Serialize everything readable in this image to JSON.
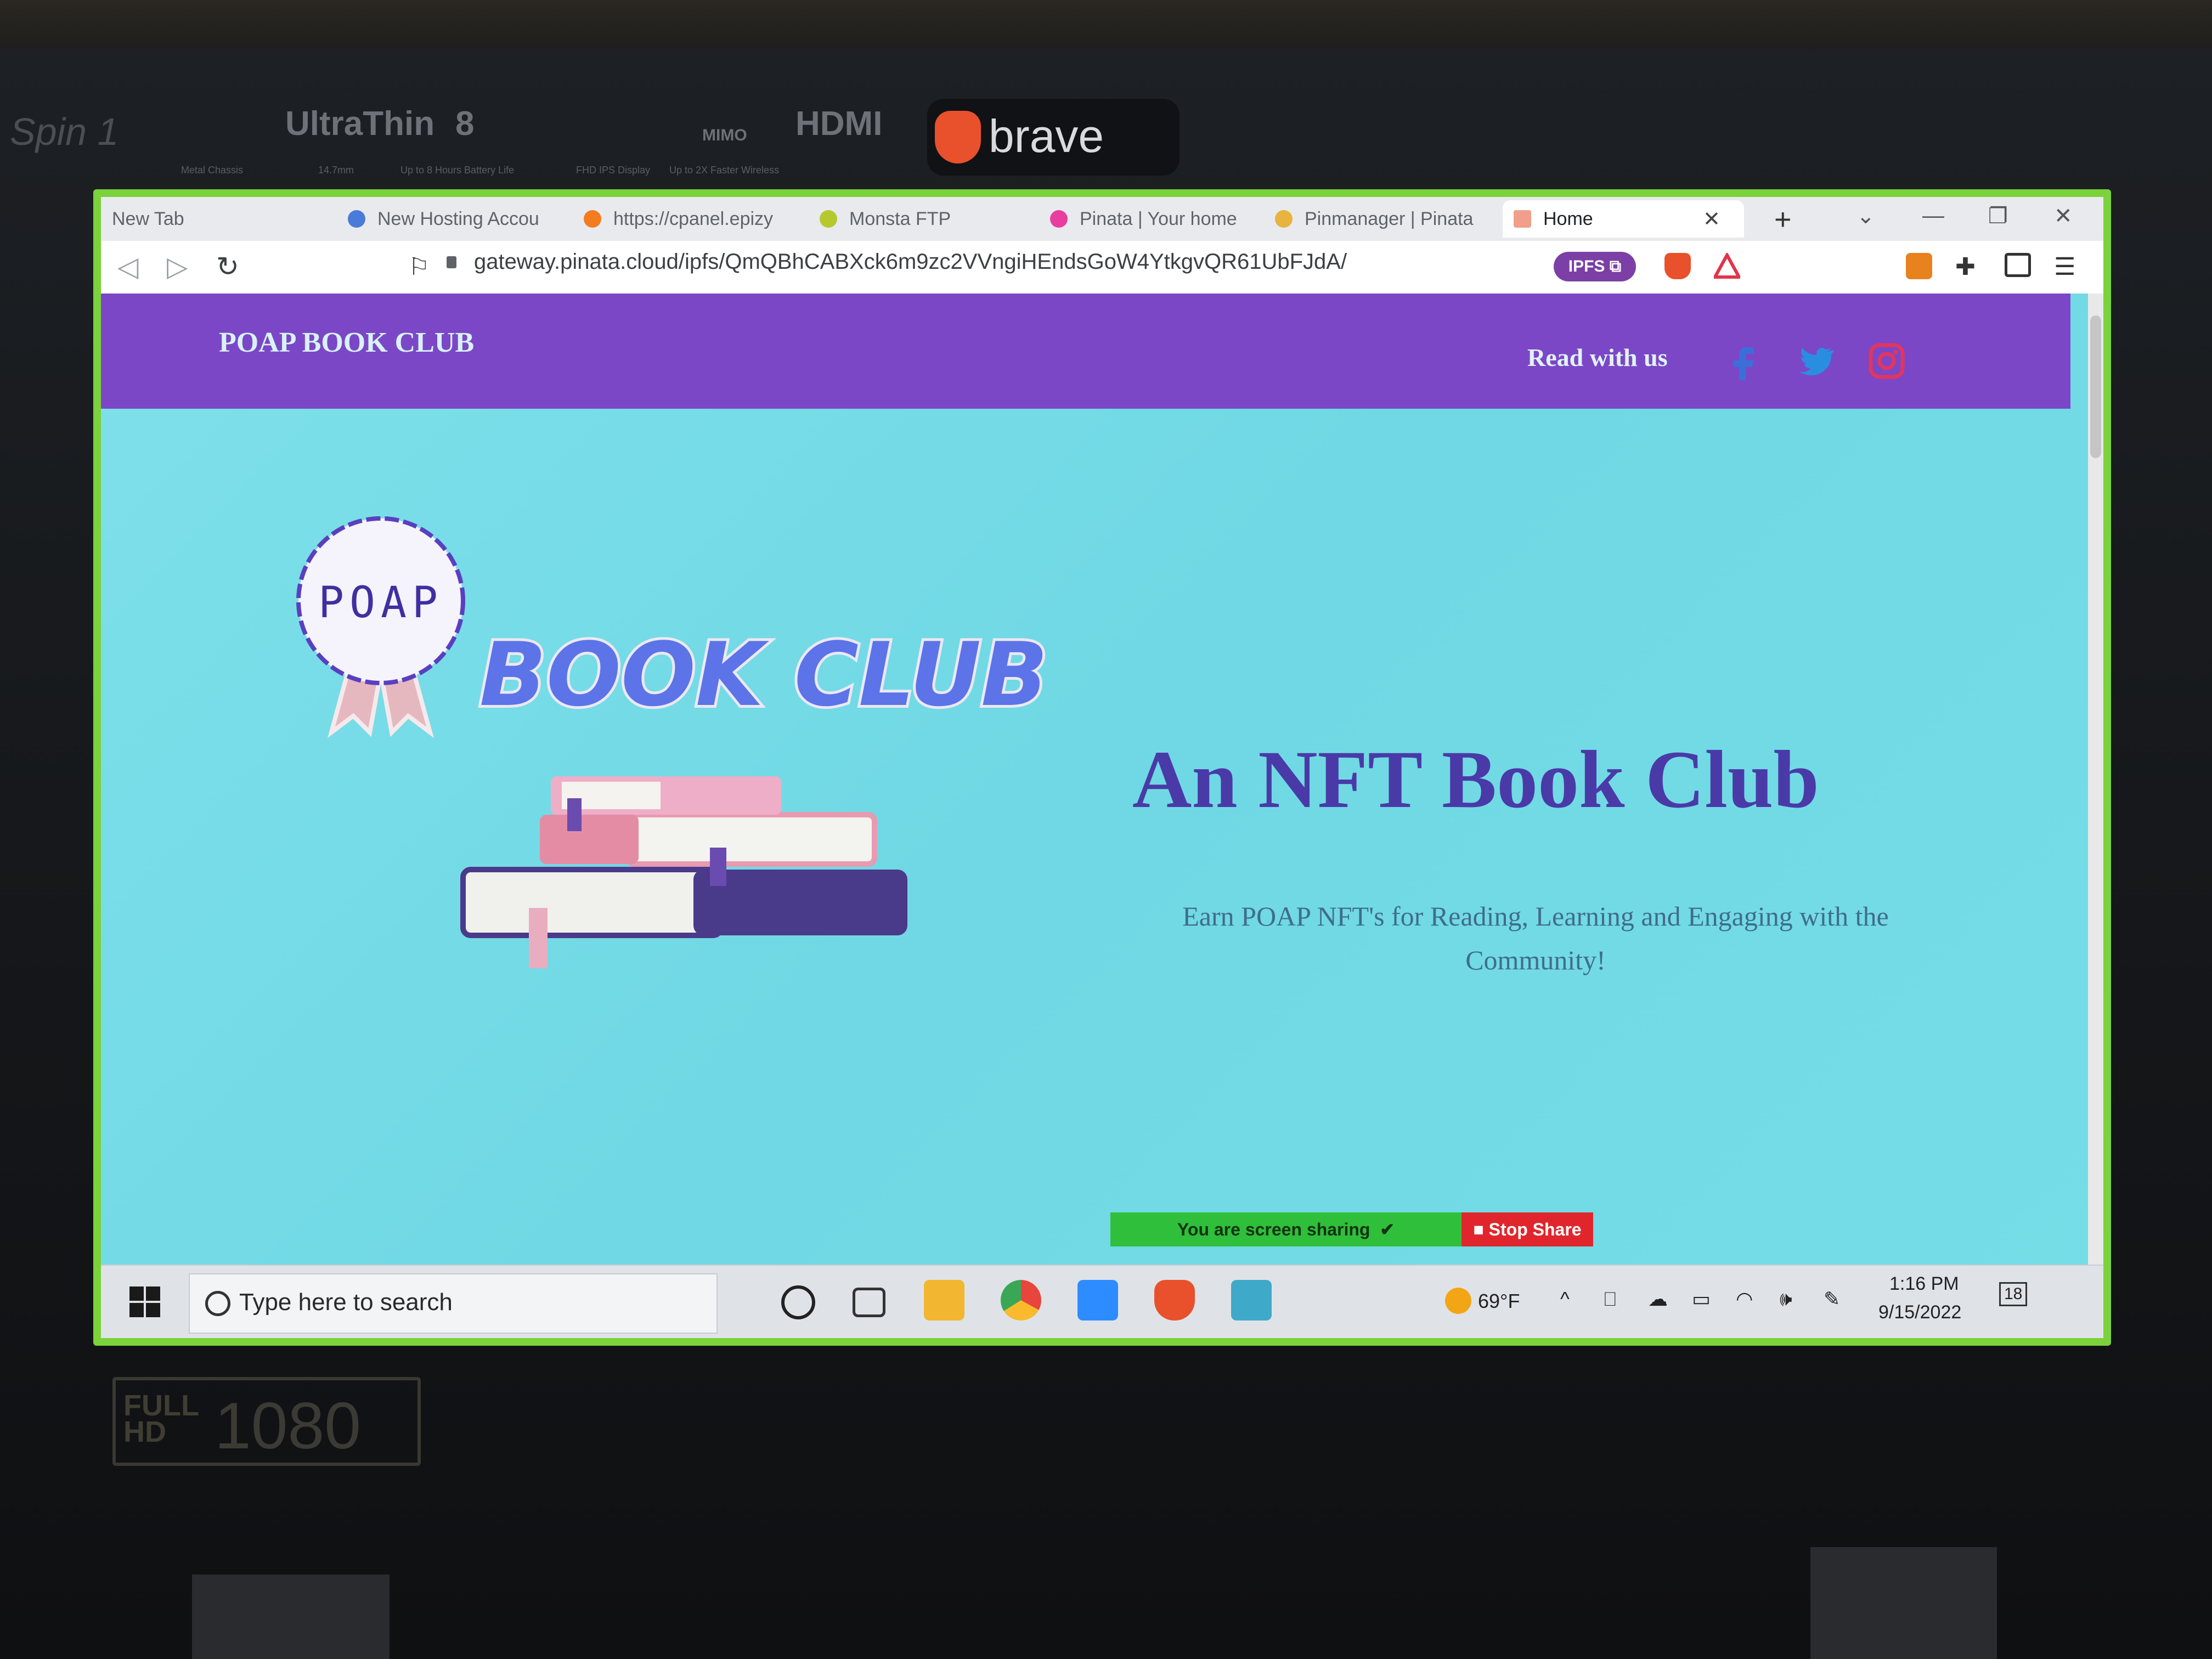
{
  "laptop": {
    "brand": "Spin 1",
    "stickers": [
      "UltraThin",
      "8",
      "MIMO",
      "HDMI"
    ],
    "sticker_sub": [
      "Metal Chassis",
      "14.7mm",
      "Up to 8 Hours Battery Life",
      "FHD IPS Display",
      "Up to 2X Faster Wireless"
    ],
    "browser_badge": "brave",
    "display_badge_top": "FULL",
    "display_badge_hd": "HD",
    "display_badge_res": "1080"
  },
  "browser": {
    "tabs": [
      {
        "label": "New Tab",
        "color": "#9aa0a6"
      },
      {
        "label": "New Hosting Accou",
        "color": "#4b7bd8"
      },
      {
        "label": "https://cpanel.epizy",
        "color": "#f47b20"
      },
      {
        "label": "Monsta FTP",
        "color": "#b5c92f"
      },
      {
        "label": "Pinata | Your home",
        "color": "#e83ea0"
      },
      {
        "label": "Pinmanager | Pinata",
        "color": "#e8b33e"
      },
      {
        "label": "Home",
        "color": "#f0a08a"
      }
    ],
    "active_tab": "Home",
    "url": "gateway.pinata.cloud/ipfs/QmQBhCABXck6m9zc2VVngiHEndsGoW4YtkgvQR61UbFJdA/",
    "ipfs_badge": "IPFS"
  },
  "site": {
    "brand": "POAP BOOK CLUB",
    "nav_link": "Read with us",
    "social": [
      "facebook",
      "twitter",
      "instagram"
    ],
    "logo_badge": "POAP",
    "logo_text": "BOOK CLUB",
    "hero_title": "An NFT Book Club",
    "hero_subtitle": "Earn POAP NFT's for Reading, Learning and Engaging with the Community!"
  },
  "screen_share": {
    "status": "You are screen sharing",
    "stop": "Stop Share"
  },
  "taskbar": {
    "search_placeholder": "Type here to search",
    "weather": "69°F",
    "time": "1:16 PM",
    "date": "9/15/2022",
    "notifications": "18"
  },
  "colors": {
    "site_nav": "#7b47c7",
    "hero_bg": "#75dde6",
    "hero_title": "#4a3aa8",
    "screen_border": "#7cd23a"
  }
}
